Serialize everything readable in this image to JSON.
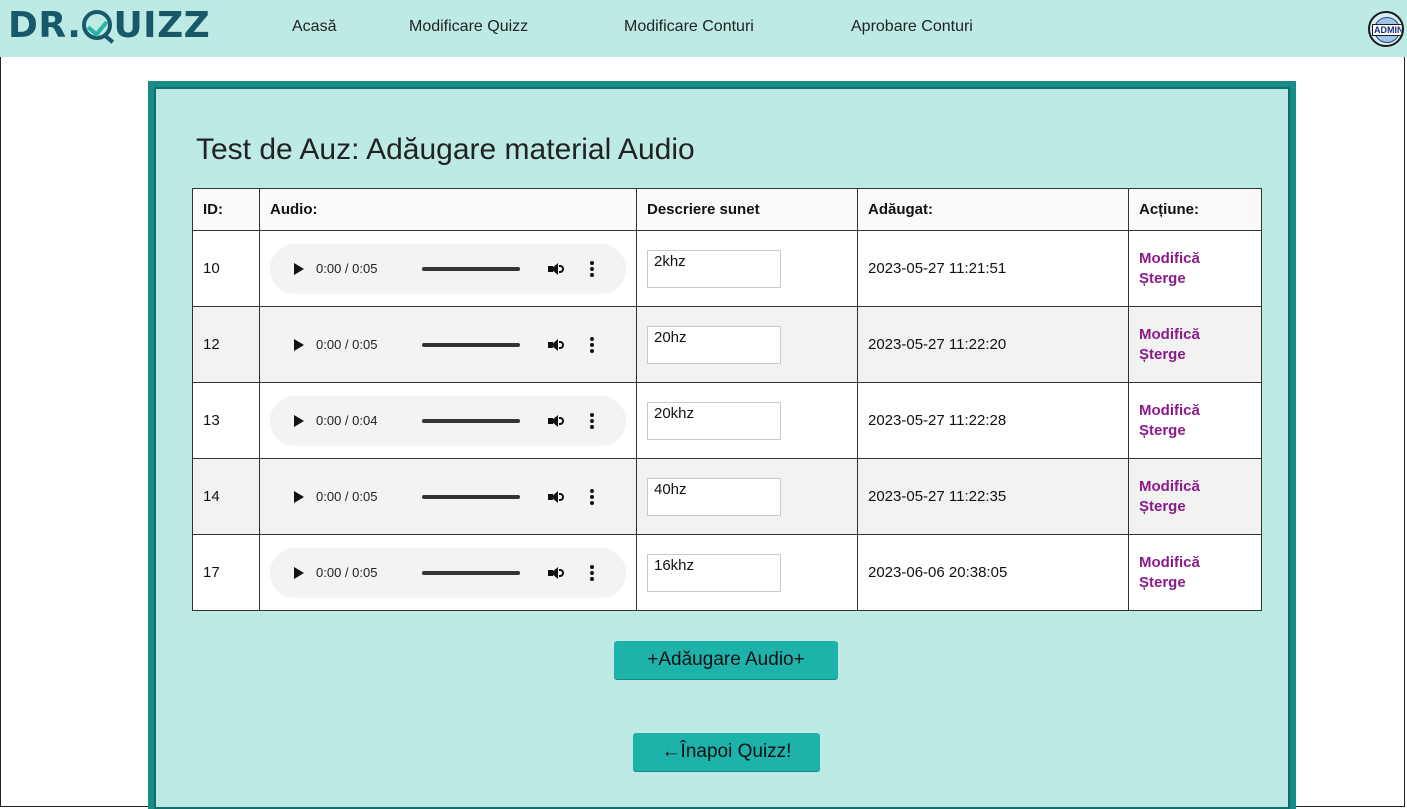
{
  "header": {
    "logo_left": "DR.",
    "logo_right": "UIZZ",
    "nav": [
      "Acasă",
      "Modificare Quizz",
      "Modificare Conturi",
      "Aprobare Conturi"
    ],
    "admin_badge": "ADMIN"
  },
  "main": {
    "title": "Test de Auz: Adăugare material Audio",
    "columns": [
      "ID:",
      "Audio:",
      "Descriere sunet",
      "Adăugat:",
      "Acțiune:"
    ],
    "rows": [
      {
        "id": "10",
        "time": "0:00 / 0:05",
        "description": "2khz",
        "added": "2023-05-27 11:21:51",
        "edit": "Modifică",
        "delete": "Șterge"
      },
      {
        "id": "12",
        "time": "0:00 / 0:05",
        "description": "20hz",
        "added": "2023-05-27 11:22:20",
        "edit": "Modifică",
        "delete": "Șterge"
      },
      {
        "id": "13",
        "time": "0:00 / 0:04",
        "description": "20khz",
        "added": "2023-05-27 11:22:28",
        "edit": "Modifică",
        "delete": "Șterge"
      },
      {
        "id": "14",
        "time": "0:00 / 0:05",
        "description": "40hz",
        "added": "2023-05-27 11:22:35",
        "edit": "Modifică",
        "delete": "Șterge"
      },
      {
        "id": "17",
        "time": "0:00 / 0:05",
        "description": "16khz",
        "added": "2023-06-06 20:38:05",
        "edit": "Modifică",
        "delete": "Șterge"
      }
    ],
    "add_button": "+Adăugare Audio+",
    "back_button": "←Înapoi Quizz!"
  },
  "colors": {
    "header_bg": "#bdeae4",
    "panel_bg": "#bdeae4",
    "panel_border": "#1a8c88",
    "button_bg": "#1db3aa",
    "link_color": "#8b1a8b",
    "logo_color": "#17596a"
  },
  "icons": [
    "play-icon",
    "volume-icon",
    "more-options-icon",
    "admin-globe-icon",
    "logo-check-icon"
  ]
}
